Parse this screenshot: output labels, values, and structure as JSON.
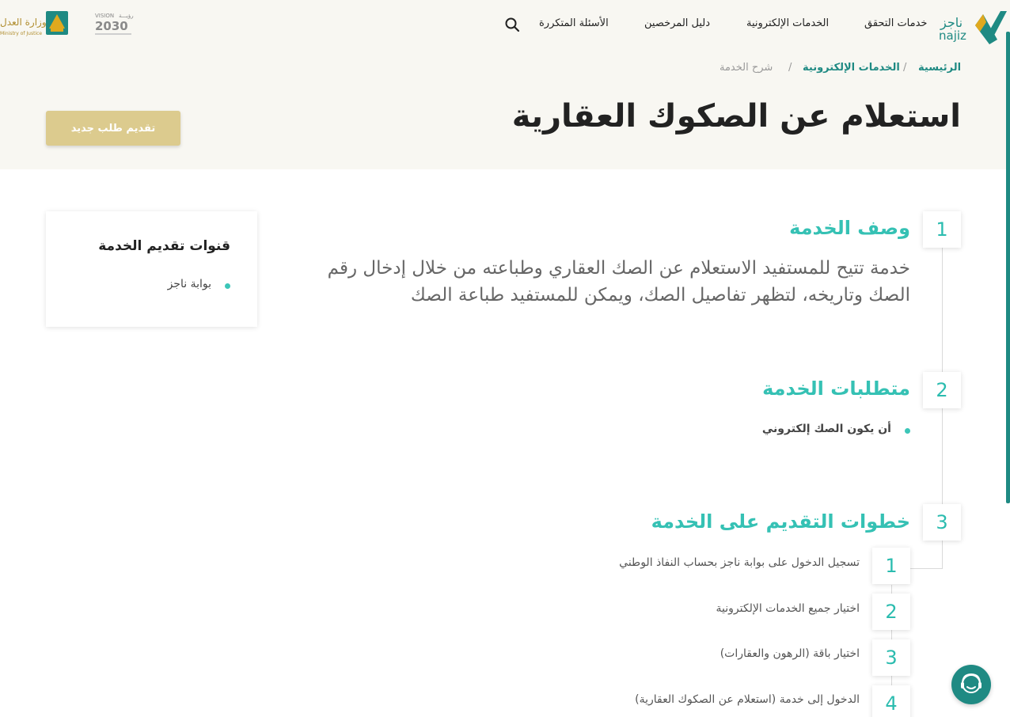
{
  "header": {
    "nav": [
      "خدمات التحقق",
      "الخدمات الإلكترونية",
      "دليل المرخصين",
      "الأسئلة المتكررة"
    ],
    "najiz_logo_ar": "ناجز",
    "najiz_logo_en": "najiz",
    "vision_label": "VISION",
    "vision_ar": "رؤيـــة",
    "vision_year": "2030",
    "moj_ar": "وزارة العدل",
    "moj_en": "Ministry of Justice"
  },
  "breadcrumb": {
    "home": "الرئيسية",
    "section": "الخدمات الإلكترونية",
    "current": "شرح الخدمة",
    "separator": "/"
  },
  "page": {
    "title": "استعلام عن الصكوك العقارية",
    "new_request_button": "تقديم طلب جديد"
  },
  "channels": {
    "title": "قنوات تقديم الخدمة",
    "items": [
      "بوابة ناجز"
    ]
  },
  "sections": [
    {
      "number": "1",
      "title": "وصف الخدمة",
      "description": "خدمة تتيح للمستفيد الاستعلام عن الصك العقاري وطباعته من خلال إدخال رقم الصك وتاريخه، لتظهر تفاصيل الصك، ويمكن للمستفيد طباعة الصك"
    },
    {
      "number": "2",
      "title": "متطلبات الخدمة",
      "requirements": [
        "أن يكون الصك إلكتروني"
      ]
    },
    {
      "number": "3",
      "title": "خطوات التقديم على الخدمة",
      "steps": [
        {
          "number": "1",
          "text": "تسجيل الدخول على بوابة ناجز بحساب النفاذ الوطني"
        },
        {
          "number": "2",
          "text": "اختيار جميع الخدمات الإلكترونية"
        },
        {
          "number": "3",
          "text": "اختيار باقة (الرهون والعقارات)"
        },
        {
          "number": "4",
          "text": "الدخول إلى خدمة (استعلام عن الصكوك العقارية)"
        }
      ]
    }
  ],
  "colors": {
    "teal": "#35c1b4",
    "dark_teal": "#1f8a83",
    "gold": "#dccb8e",
    "hero_bg": "#f8f7f2"
  },
  "icons": {
    "search": "search-icon",
    "support": "headset-icon"
  }
}
